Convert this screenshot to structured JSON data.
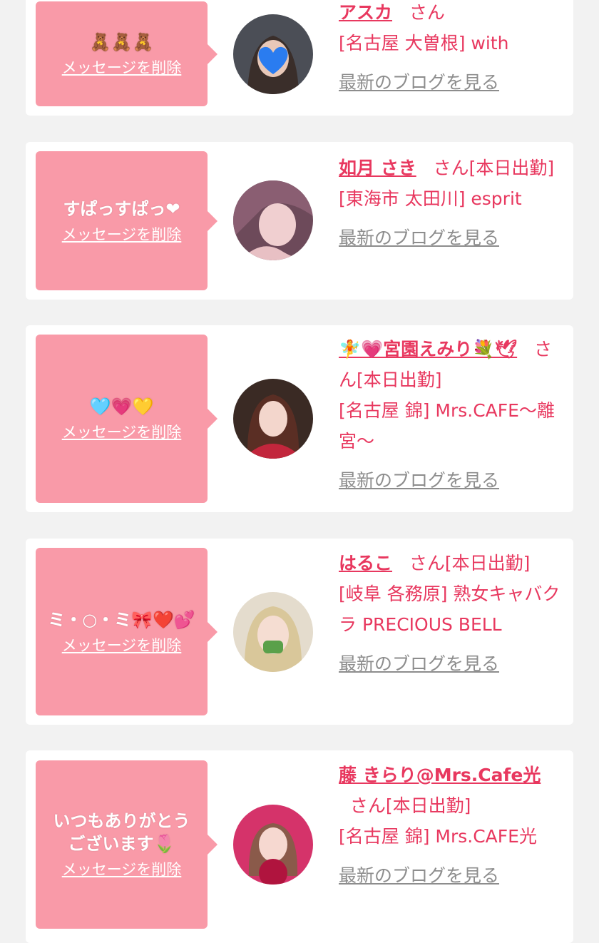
{
  "cards": [
    {
      "message": "🧸🧸🧸",
      "delete_label": "メッセージを削除",
      "name": "アスカ",
      "san": "さん",
      "status": "",
      "location": "[名古屋 大曽根] with",
      "blog_label": "最新のブログを見る",
      "avatar_bg": "#4b4e56"
    },
    {
      "message": "すぱっすぱっ❤",
      "delete_label": "メッセージを削除",
      "name": "如月 さき",
      "san": "さん",
      "status": "[本日出勤]",
      "location": "[東海市 太田川] esprit",
      "blog_label": "最新のブログを見る",
      "avatar_bg": "#6d4a5a"
    },
    {
      "message": "🩵💗💛",
      "delete_label": "メッセージを削除",
      "name": "🧚💗宮園えみり💐🕊",
      "san": "さん",
      "status": "[本日出勤]",
      "location": "[名古屋 錦] Mrs.CAFE～離宮～",
      "blog_label": "最新のブログを見る",
      "avatar_bg": "#7a3a3a"
    },
    {
      "message": "ミ・○・ミ🎀❤️💕",
      "delete_label": "メッセージを削除",
      "name": "はるこ",
      "san": "さん",
      "status": "[本日出勤]",
      "location": "[岐阜 各務原] 熟女キャバクラ PRECIOUS BELL",
      "blog_label": "最新のブログを見る",
      "avatar_bg": "#d9c9a8"
    },
    {
      "message": "いつもありがとう\nございます🌷",
      "delete_label": "メッセージを削除",
      "name": "藤 きらり@Mrs.Cafe光",
      "san": "さん",
      "status": "[本日出勤]",
      "location": "[名古屋 錦] Mrs.CAFE光",
      "blog_label": "最新のブログを見る",
      "avatar_bg": "#d5336a"
    }
  ]
}
